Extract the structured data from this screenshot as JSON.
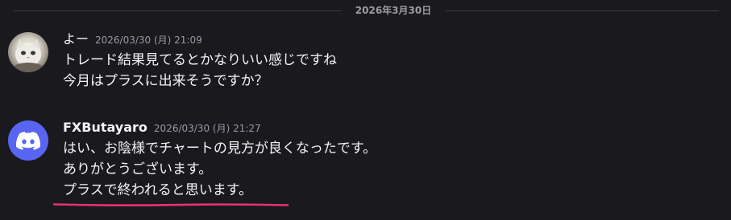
{
  "date_divider": "2026年3月30日",
  "messages": [
    {
      "username": "よー",
      "timestamp": "2026/03/30 (月) 21:09",
      "avatar": "cat-photo-avatar",
      "lines": [
        "トレード結果見てるとかなりいい感じですね",
        "今月はプラスに出来そうですか？"
      ]
    },
    {
      "username": "FXButayaro",
      "timestamp": "2026/03/30 (月) 21:27",
      "avatar": "discord-logo-avatar",
      "lines": [
        "はい、お陰様でチャートの見方が良くなったです。",
        "ありがとうございます。",
        "プラスで終われると思います。"
      ]
    }
  ],
  "colors": {
    "background": "#1a1a1e",
    "discord_blurple": "#5865f2",
    "annotation_underline": "#e8336d"
  }
}
